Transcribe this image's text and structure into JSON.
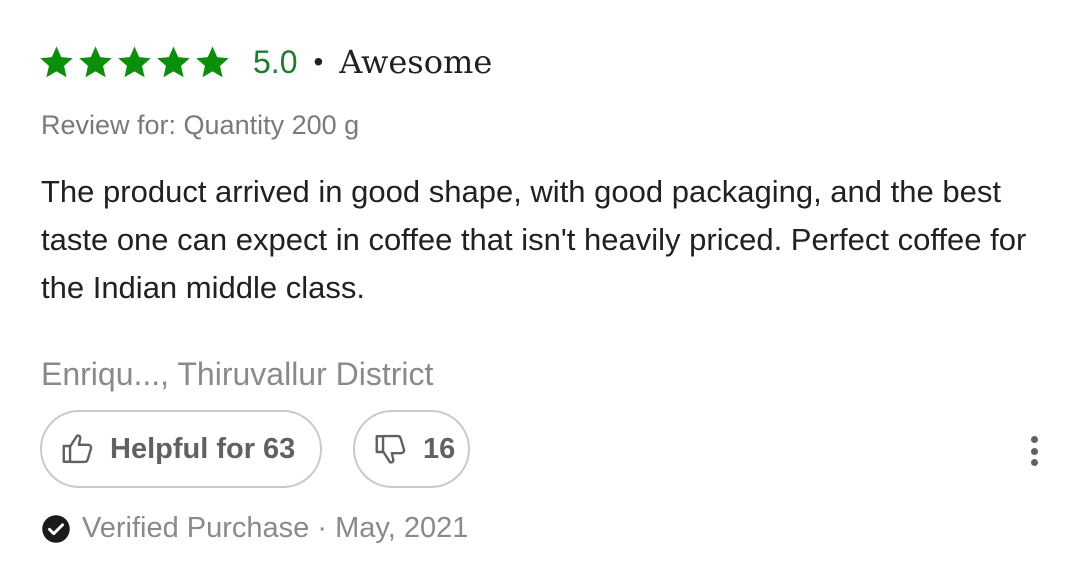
{
  "review": {
    "rating_value": "5.0",
    "rating_stars": 5,
    "rating_max": 5,
    "separator": "•",
    "verdict": "Awesome",
    "variant": "Review for: Quantity 200 g",
    "text": "The product arrived in good shape, with good packaging, and the best taste one can expect in coffee that isn't heavily priced. Perfect coffee for the Indian middle class.",
    "author": "Enriqu..., Thiruvallur District",
    "helpful_label": "Helpful for 63",
    "dislike_count": "16",
    "verified_line": "Verified Purchase · May, 2021"
  },
  "icons": {
    "star": "star-icon",
    "thumbs_up": "thumbs-up-icon",
    "thumbs_down": "thumbs-down-icon",
    "more": "more-vertical-icon",
    "verified": "check-circle-icon"
  },
  "colors": {
    "star_green": "#0a8f08",
    "score_green": "#1a7f2a",
    "muted_text": "#8a8a8a",
    "button_border": "#c9c9c9"
  }
}
